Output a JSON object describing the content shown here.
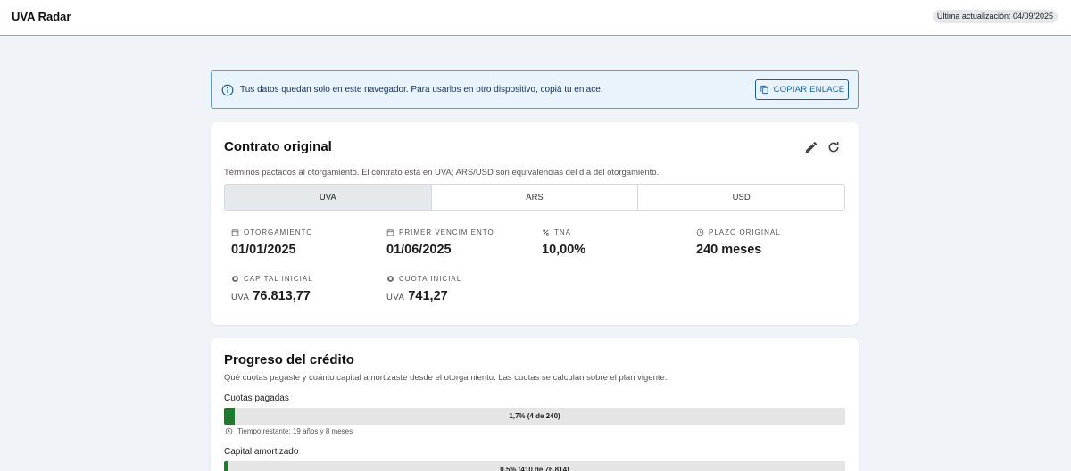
{
  "app": {
    "title": "UVA Radar",
    "last_update": "Última actualización: 04/09/2025"
  },
  "banner": {
    "text": "Tus datos quedan solo en este navegador. Para usarlos en otro dispositivo, copiá tu enlace.",
    "copy_button": "COPIAR ENLACE",
    "icon": "info-icon"
  },
  "contract": {
    "title": "Contrato original",
    "subtitle": "Términos pactados al otorgamiento. El contrato está en UVA; ARS/USD son equivalencias del día del otorgamiento.",
    "tabs": [
      {
        "label": "UVA",
        "active": true
      },
      {
        "label": "ARS",
        "active": false
      },
      {
        "label": "USD",
        "active": false
      }
    ],
    "fields": {
      "otorgamiento": {
        "label": "OTORGAMIENTO",
        "value": "01/01/2025",
        "icon": "calendar-icon"
      },
      "primer_vencimiento": {
        "label": "PRIMER VENCIMIENTO",
        "value": "01/06/2025",
        "icon": "calendar-icon"
      },
      "tna": {
        "label": "TNA",
        "value": "10,00%",
        "icon": "percent-icon"
      },
      "plazo": {
        "label": "PLAZO ORIGINAL",
        "value": "240 meses",
        "icon": "clock-icon"
      },
      "capital": {
        "label": "CAPITAL INICIAL",
        "unit": "UVA",
        "value": "76.813,77",
        "icon": "coins-icon"
      },
      "cuota": {
        "label": "CUOTA INICIAL",
        "unit": "UVA",
        "value": "741,27",
        "icon": "coins-icon"
      }
    }
  },
  "progress": {
    "title": "Progreso del crédito",
    "subtitle": "Qué cuotas pagaste y cuánto capital amortizaste desde el otorgamiento. Las cuotas se calculan sobre el plan vigente.",
    "cuotas": {
      "label": "Cuotas pagadas",
      "text": "1,7% (4 de 240)",
      "fraction": 0.017,
      "remaining": "Tiempo restante: 19 años y 8 meses"
    },
    "capital": {
      "label": "Capital amortizado",
      "text": "0,5% (410 de 76.814)",
      "fraction": 0.005
    }
  },
  "colors": {
    "accent": "#1f5f99",
    "progress_fill": "#1e7a2d",
    "background": "#f0f4f8"
  }
}
